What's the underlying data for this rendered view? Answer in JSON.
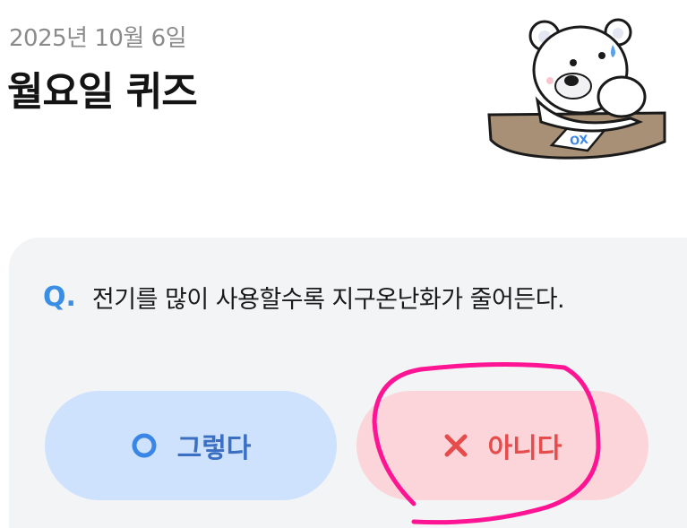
{
  "header": {
    "date": "2025년 10월 6일",
    "title": "월요일 퀴즈"
  },
  "mascot": {
    "icon": "polar-bear-mascot-icon",
    "card_text": "OX"
  },
  "quiz": {
    "q_mark": "Q.",
    "question": "전기를 많이 사용할수록 지구온난화가 줄어든다.",
    "answers": [
      {
        "label": "그렇다",
        "icon": "circle-o-icon",
        "color": "#3a86e6"
      },
      {
        "label": "아니다",
        "icon": "x-icon",
        "color": "#e74c4c"
      }
    ]
  },
  "annotation": {
    "type": "hand-drawn-circle",
    "color": "#ff1493"
  }
}
